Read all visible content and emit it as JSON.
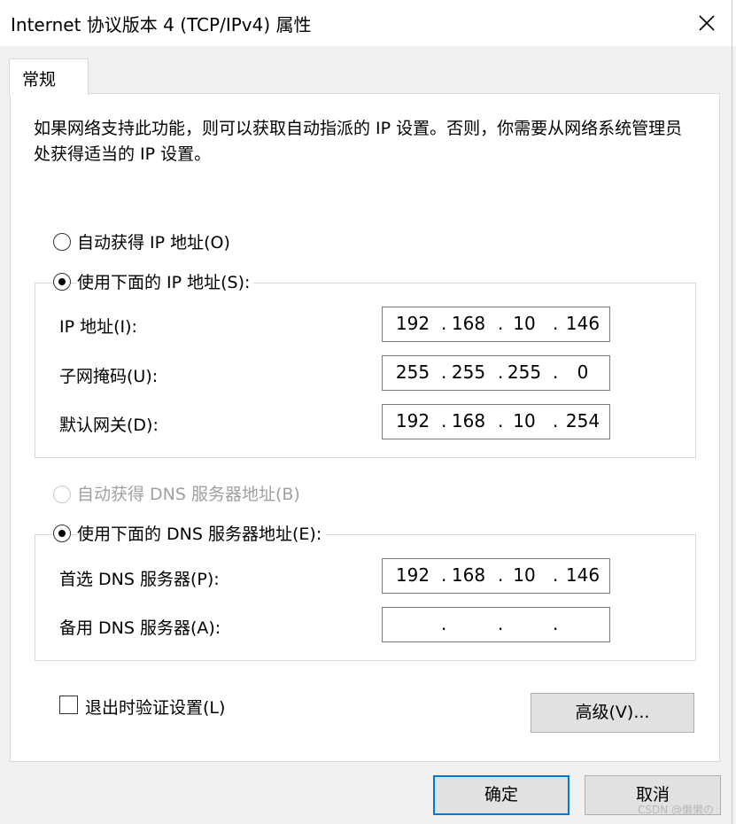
{
  "window": {
    "title": "Internet 协议版本 4 (TCP/IPv4) 属性",
    "close_icon": "close-icon"
  },
  "tab": {
    "label": "常规"
  },
  "description": "如果网络支持此功能，则可以获取自动指派的 IP 设置。否则，你需要从网络系统管理员处获得适当的 IP 设置。",
  "ip_section": {
    "auto_label": "自动获得 IP 地址(O)",
    "auto_checked": false,
    "manual_label": "使用下面的 IP 地址(S):",
    "manual_checked": true,
    "ip_address": {
      "label": "IP 地址(I):",
      "octets": [
        "192",
        "168",
        "10",
        "146"
      ]
    },
    "subnet_mask": {
      "label": "子网掩码(U):",
      "octets": [
        "255",
        "255",
        "255",
        "0"
      ]
    },
    "gateway": {
      "label": "默认网关(D):",
      "octets": [
        "192",
        "168",
        "10",
        "254"
      ]
    }
  },
  "dns_section": {
    "auto_label": "自动获得 DNS 服务器地址(B)",
    "auto_checked": false,
    "auto_disabled": true,
    "manual_label": "使用下面的 DNS 服务器地址(E):",
    "manual_checked": true,
    "preferred": {
      "label": "首选 DNS 服务器(P):",
      "octets": [
        "192",
        "168",
        "10",
        "146"
      ]
    },
    "alternate": {
      "label": "备用 DNS 服务器(A):",
      "octets": [
        "",
        "",
        "",
        ""
      ]
    }
  },
  "validate": {
    "label": "退出时验证设置(L)",
    "checked": false
  },
  "buttons": {
    "advanced": "高级(V)...",
    "ok": "确定",
    "cancel": "取消"
  },
  "watermark": "CSDN @懒懒の"
}
